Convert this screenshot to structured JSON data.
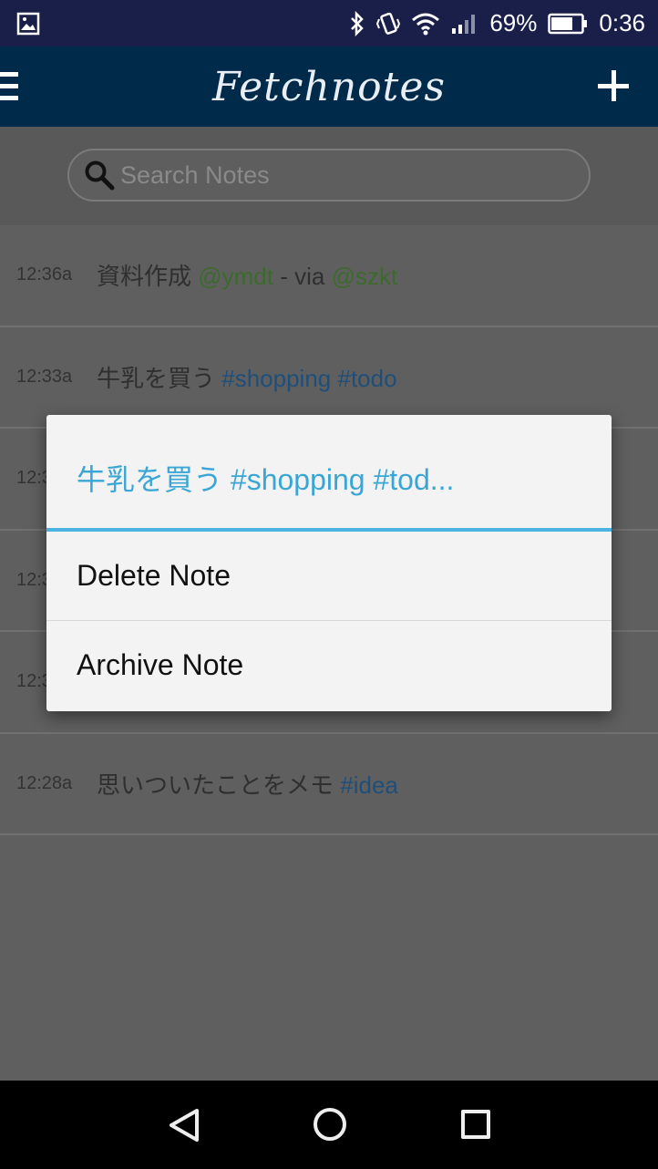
{
  "status": {
    "battery": "69%",
    "time": "0:36"
  },
  "appbar": {
    "title": "Fetchnotes"
  },
  "search": {
    "placeholder": "Search Notes"
  },
  "notes": [
    {
      "time": "12:36a",
      "text": "資料作成",
      "mention1": "@ymdt",
      "via": " - via ",
      "mention2": "@szkt"
    },
    {
      "time": "12:33a",
      "text": "牛乳を買う",
      "tag1": "#shopping",
      "tag2": "#todo"
    },
    {
      "time": "12:3"
    },
    {
      "time": "12:3"
    },
    {
      "time": "12:3"
    },
    {
      "time": "12:28a",
      "text": "思いついたことをメモ",
      "tag1": "#idea"
    }
  ],
  "dialog": {
    "title": "牛乳を買う #shopping #tod...",
    "items": [
      "Delete Note",
      "Archive Note"
    ]
  },
  "colors": {
    "statusbar": "#1a1f4a",
    "appbar": "#002a4a",
    "accent": "#3aa6d6",
    "mention": "#3c6a2c",
    "tag": "#1f4e78"
  },
  "icons": {
    "status": [
      "image-icon",
      "bluetooth-icon",
      "vibrate-icon",
      "wifi-icon",
      "signal-icon",
      "battery-icon"
    ],
    "nav": [
      "back-icon",
      "home-icon",
      "recents-icon"
    ]
  }
}
